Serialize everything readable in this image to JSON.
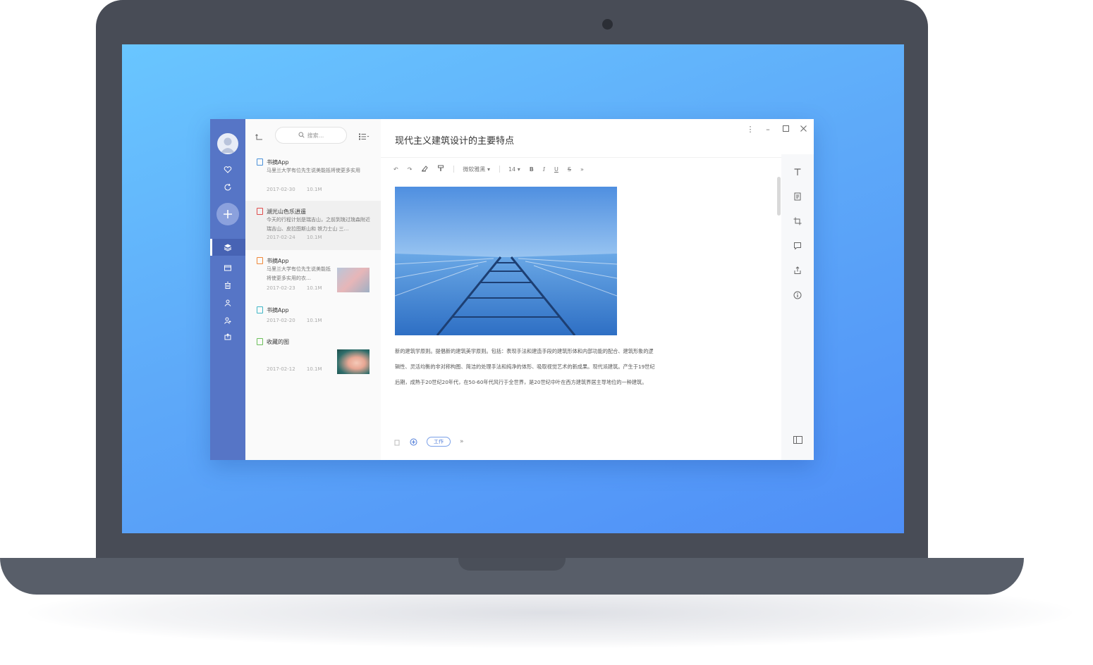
{
  "search": {
    "placeholder": "搜索..."
  },
  "notes": [
    {
      "title": "书摘App",
      "excerpt": "马里兰大学有位先生说美能抵将使更多实用",
      "date": "2017-02-30",
      "size": "10.1M",
      "icon_color": "#4a90d9"
    },
    {
      "title": "湖光山色乐逍遥",
      "excerpt": "今天的行程计划是瑞吉山，之前到琉过琉森附近瑞吉山、皮拉图斯山和 铁力士山 三…",
      "date": "2017-02-24",
      "size": "10.1M",
      "icon_color": "#e04b4b",
      "selected": true
    },
    {
      "title": "书摘App",
      "excerpt": "马里兰大学有位先生说美能抵将使更多实用的衣…",
      "date": "2017-02-23",
      "size": "10.1M",
      "icon_color": "#f0883a",
      "has_thumb": true
    },
    {
      "title": "书摘App",
      "excerpt": "",
      "date": "2017-02-20",
      "size": "10.1M",
      "icon_color": "#3fb6c6"
    },
    {
      "title": "收藏的图",
      "excerpt": "",
      "date": "2017-02-12",
      "size": "10.1M",
      "icon_color": "#6cbf5a",
      "has_thumb": true
    }
  ],
  "editor": {
    "title": "现代主义建筑设计的主要特点",
    "toolbar": {
      "font": "微软雅黑",
      "font_size": "14",
      "bold": "B",
      "italic": "I",
      "underline": "U",
      "strike": "S"
    },
    "paragraphs": [
      "新的建筑学原则。提倡新的建筑美学原则。包括：表现手法和建造手段的建筑形体和内部功能的配合、建筑形象的逻",
      "辑性、灵活均衡的非对称构图、简洁的处理手法和纯净的体形、吸取视觉艺术的新成果。现代派建筑。产生于19世纪",
      "后期，成熟于20世纪20年代，在50-60年代风行于全世界，是20世纪中叶在西方建筑界居主导地位的一种建筑。"
    ],
    "tag": "工作"
  },
  "colors": {
    "sidebar": "#5675c6",
    "accent": "#4f7cd8",
    "screen_top": "#69c6ff",
    "screen_bottom": "#4f8ff7"
  }
}
